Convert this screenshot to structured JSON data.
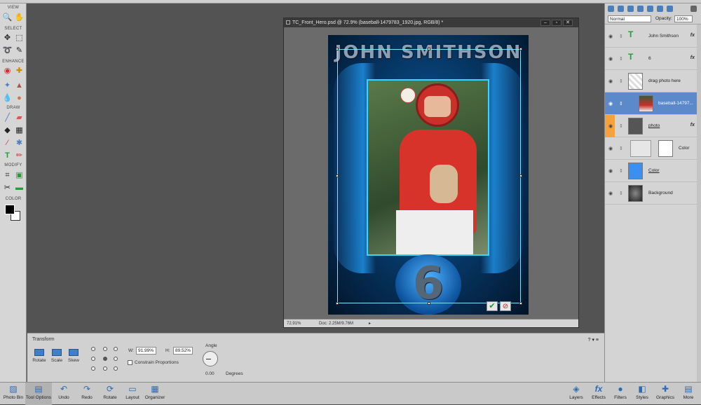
{
  "toolbox": {
    "sections": [
      "VIEW",
      "SELECT",
      "ENHANCE",
      "DRAW",
      "MODIFY",
      "COLOR"
    ]
  },
  "document": {
    "title": "TC_Front_Hero.psd @ 72.9% (baseball-1479783_1920.jpg, RGB/8) *",
    "zoom": "72.91%",
    "doc_size": "Doc: 2.25M/9.76M",
    "art_name": "JOHN SMITHSON",
    "art_number": "6"
  },
  "options": {
    "title": "Transform",
    "buttons": [
      "Rotate",
      "Scale",
      "Skew"
    ],
    "w_label": "W:",
    "w_value": "91.99%",
    "h_label": "H:",
    "h_value": "89.52%",
    "constrain": "Constrain Proportions",
    "angle_label": "Angle",
    "angle_value": "0.00",
    "degrees": "Degrees"
  },
  "layers_panel": {
    "blend_mode": "Normal",
    "opacity_label": "Opacity:",
    "opacity_value": "100%",
    "layers": [
      {
        "name": "John Smithson",
        "type": "text",
        "fx": "fx"
      },
      {
        "name": "6",
        "type": "text",
        "fx": "fx"
      },
      {
        "name": "drag photo here",
        "type": "raster"
      },
      {
        "name": "baseball-14797...",
        "type": "photo",
        "selected": true
      },
      {
        "name": "photo",
        "type": "shape",
        "fx": "fx"
      },
      {
        "name": "Color",
        "type": "adjustment"
      },
      {
        "name": "Color",
        "type": "fill"
      },
      {
        "name": "Background",
        "type": "raster"
      }
    ]
  },
  "bottombar": {
    "left": [
      "Photo Bin",
      "Tool Options",
      "Undo",
      "Redo",
      "Rotate",
      "Layout",
      "Organizer"
    ],
    "right": [
      "Layers",
      "Effects",
      "Filters",
      "Styles",
      "Graphics",
      "More"
    ]
  },
  "colors": {
    "accent": "#5b89c9",
    "canvas_bg": "#535353"
  }
}
